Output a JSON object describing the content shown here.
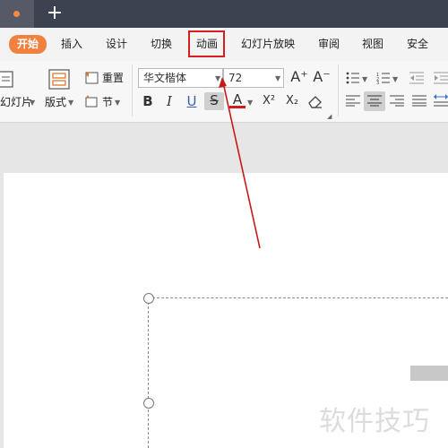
{
  "titlebar": {
    "new_tab": "+"
  },
  "menu": {
    "items": [
      "开始",
      "插入",
      "设计",
      "切换",
      "动画",
      "幻灯片放映",
      "审阅",
      "视图",
      "安全"
    ],
    "active": "开始",
    "highlighted": "动画"
  },
  "ribbon": {
    "new_slide_label": "幻灯片",
    "layout_label": "版式",
    "reset_label": "重置",
    "section_label": "节",
    "font_name": "华文楷体",
    "font_size": "72",
    "bold": "B",
    "italic": "I",
    "underline": "U",
    "strikethrough": "S",
    "font_color": "A",
    "superscript": "X²",
    "subscript": "X₂",
    "grow_font": "A⁺",
    "shrink_font": "A⁻"
  },
  "workspace": {
    "watermark": "软件技巧"
  },
  "colors": {
    "accent": "#f0813f",
    "highlight_box": "#d81e1e",
    "arrow": "#c41a1a"
  },
  "icons": [
    "plus-icon",
    "bullet-list-icon",
    "numbered-list-icon",
    "outdent-icon",
    "indent-icon",
    "align-left-icon",
    "align-center-icon",
    "align-right-icon",
    "justify-icon",
    "eraser-icon"
  ]
}
